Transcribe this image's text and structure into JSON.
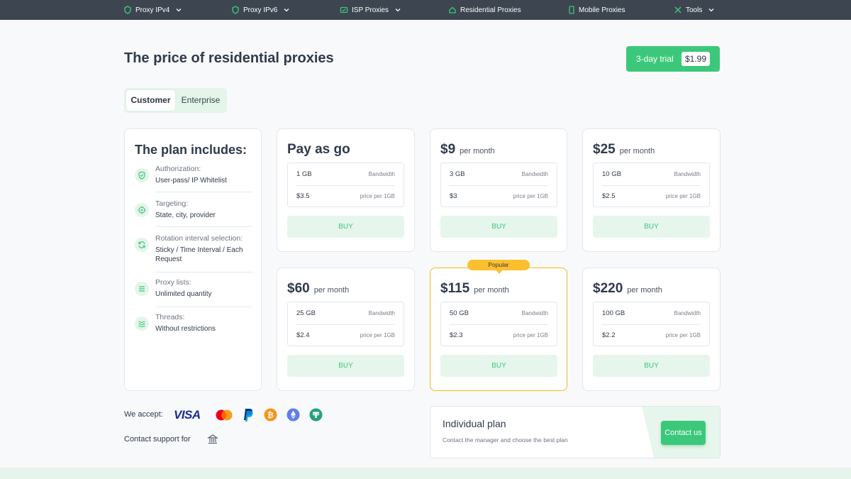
{
  "nav": {
    "items": [
      {
        "label": "Proxy IPv4",
        "icon": "proxy-icon",
        "dropdown": true
      },
      {
        "label": "Proxy IPv6",
        "icon": "proxy-icon",
        "dropdown": true
      },
      {
        "label": "ISP Proxies",
        "icon": "isp-icon",
        "dropdown": true
      },
      {
        "label": "Residential Proxies",
        "icon": "home-icon",
        "dropdown": false
      },
      {
        "label": "Mobile Proxies",
        "icon": "mobile-icon",
        "dropdown": false
      },
      {
        "label": "Tools",
        "icon": "tools-icon",
        "dropdown": true
      }
    ]
  },
  "page": {
    "title": "The price of residential proxies"
  },
  "trial": {
    "label": "3-day trial",
    "price": "$1.99"
  },
  "tabs": {
    "active": "Customer",
    "inactive": "Enterprise"
  },
  "plan": {
    "title": "The plan includes:",
    "features": [
      {
        "label": "Authorization:",
        "value": "User-pass/ IP Whitelist",
        "icon": "shield-check-icon"
      },
      {
        "label": "Targeting:",
        "value": "State, city, provider",
        "icon": "target-icon"
      },
      {
        "label": "Rotation interval selection:",
        "value": "Sticky / Time Interval / Each Request",
        "icon": "rotate-icon"
      },
      {
        "label": "Proxy lists:",
        "value": "Unlimited quantity",
        "icon": "list-icon"
      },
      {
        "label": "Threads:",
        "value": "Without restrictions",
        "icon": "waves-icon"
      }
    ]
  },
  "pricing": {
    "bandwidth_label": "Bandwidth",
    "price_label": "price per 1GB",
    "buy_label": "BUY",
    "popular_label": "Popular",
    "cards": [
      {
        "price": "Pay as go",
        "per": "",
        "bandwidth": "1 GB",
        "per_gb": "$3.5",
        "popular": false
      },
      {
        "price": "$9",
        "per": "per month",
        "bandwidth": "3 GB",
        "per_gb": "$3",
        "popular": false
      },
      {
        "price": "$25",
        "per": "per month",
        "bandwidth": "10 GB",
        "per_gb": "$2.5",
        "popular": false
      },
      {
        "price": "$60",
        "per": "per month",
        "bandwidth": "25 GB",
        "per_gb": "$2.4",
        "popular": false
      },
      {
        "price": "$115",
        "per": "per month",
        "bandwidth": "50 GB",
        "per_gb": "$2.3",
        "popular": true
      },
      {
        "price": "$220",
        "per": "per month",
        "bandwidth": "100 GB",
        "per_gb": "$2.2",
        "popular": false
      }
    ]
  },
  "payments": {
    "accept_label": "We accept:",
    "methods": [
      "VISA",
      "mastercard-icon",
      "paypal-icon",
      "bitcoin-icon",
      "ethereum-icon",
      "tether-icon"
    ],
    "visa_text": "VISA",
    "support_label": "Contact support for",
    "support_icon": "bank-icon"
  },
  "individual": {
    "title": "Individual plan",
    "subtitle": "Contact the manager and choose the best plan",
    "button": "Contact us"
  },
  "colors": {
    "nav_bg": "#3d4550",
    "accent": "#3cc87a",
    "accent_light": "#e6f6ec",
    "popular": "#fbc02d"
  }
}
